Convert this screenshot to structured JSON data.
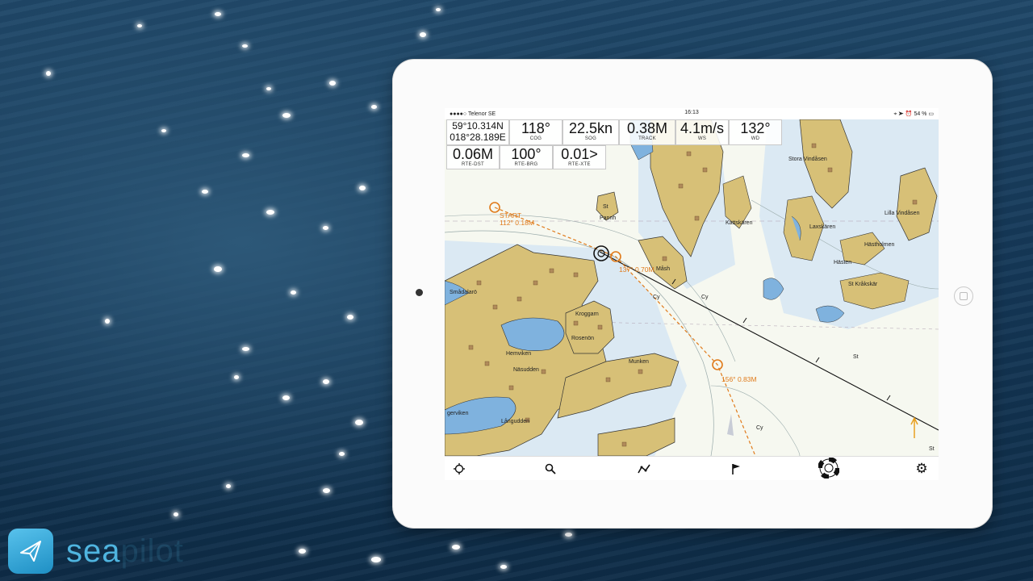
{
  "status_bar": {
    "carrier": "●●●●○ Telenor SE",
    "time": "16:13",
    "battery": "54 %"
  },
  "instruments": {
    "position": {
      "lat": "59°10.314N",
      "lon": "018°28.189E"
    },
    "cog": {
      "value": "118°",
      "label": "COG"
    },
    "sog": {
      "value": "22.5kn",
      "label": "SOG"
    },
    "track": {
      "value": "0.38M",
      "label": "TRACK"
    },
    "ws": {
      "value": "4.1m/s",
      "label": "WS"
    },
    "wd": {
      "value": "132°",
      "label": "WD"
    },
    "rte_dst": {
      "value": "0.06M",
      "label": "RTE-DST"
    },
    "rte_brg": {
      "value": "100°",
      "label": "RTE-BRG"
    },
    "rte_xte": {
      "value": "0.01>",
      "label": "RTE-XTE"
    }
  },
  "route": {
    "start_label": "START",
    "leg1": "112° 0.18M",
    "leg2": "137° 0.70M",
    "leg3": "156° 0.83M",
    "color": "#e07a1a"
  },
  "map_labels": {
    "smadalaro": "Smådalarö",
    "hemviken": "Hemviken",
    "nasudden": "Näsudden",
    "kroggarn": "Kroggarn",
    "rosenon": "Rosenön",
    "munken": "Munken",
    "langudden": "Långudden",
    "gerviken": "gerviken",
    "mash": "Måsh",
    "pannh": "Pannh",
    "kattskaren": "Kattskären",
    "stora_vindasen": "Stora Vindåsen",
    "lilla_vindasen": "Lilla Vindåsen",
    "laxskaren": "Laxskären",
    "hastholmen": "Hästholmen",
    "hasten": "Hästen",
    "st_krakskar": "St Kråkskär",
    "cy1": "Cy",
    "cy2": "Cy",
    "cy3": "Cy",
    "st1": "St",
    "st2": "St",
    "st3": "St"
  },
  "toolbar": {
    "items": [
      "locate-icon",
      "search-icon",
      "route-icon",
      "flag-icon",
      "lifebuoy-icon",
      "gear-icon"
    ]
  },
  "brand": {
    "name": "sea",
    "name_faded": "pilot"
  }
}
